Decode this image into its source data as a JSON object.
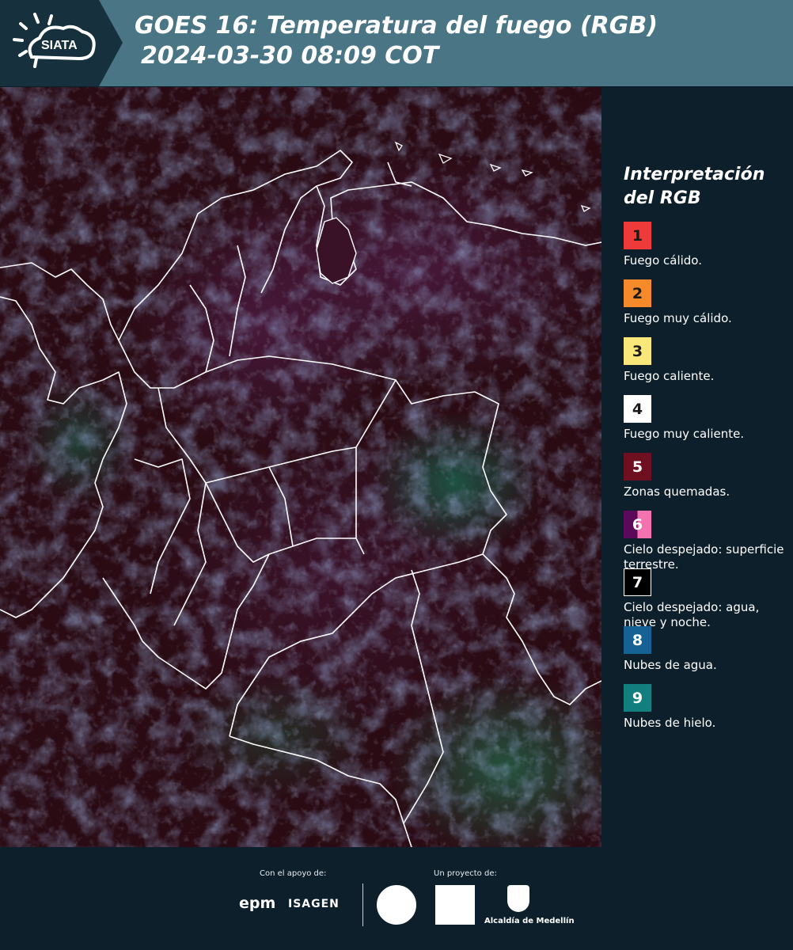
{
  "header": {
    "logo_text": "SIATA",
    "title_line1": "GOES 16: Temperatura del fuego (RGB)",
    "title_line2": "2024-03-30 08:09 COT"
  },
  "legend": {
    "title_line1": "Interpretación",
    "title_line2": "del RGB",
    "items": [
      {
        "number": "1",
        "label": "Fuego cálido.",
        "color": "#ef3a3a",
        "text_color": "#1a1a1a"
      },
      {
        "number": "2",
        "label": "Fuego muy cálido.",
        "color": "#f58a2b",
        "text_color": "#1a1a1a"
      },
      {
        "number": "3",
        "label": "Fuego caliente.",
        "color": "#fae77a",
        "text_color": "#1a1a1a"
      },
      {
        "number": "4",
        "label": "Fuego muy caliente.",
        "color": "#ffffff",
        "text_color": "#1a1a1a"
      },
      {
        "number": "5",
        "label": "Zonas quemadas.",
        "color": "#6e1020",
        "text_color": "#ffffff"
      },
      {
        "number": "6",
        "label": "Cielo despejado: superficie terrestre.",
        "color": "#5b0a5a",
        "color2": "#f273b0",
        "text_color": "#ffffff"
      },
      {
        "number": "7",
        "label": "Cielo despejado: agua, nieve y noche.",
        "color": "#000000",
        "text_color": "#ffffff"
      },
      {
        "number": "8",
        "label": "Nubes de agua.",
        "color": "#166294",
        "text_color": "#ffffff"
      },
      {
        "number": "9",
        "label": "Nubes de hielo.",
        "color": "#137e7e",
        "text_color": "#ffffff"
      }
    ]
  },
  "footer": {
    "support_label": "Con el apoyo de:",
    "project_label": "Un proyecto de:",
    "epm": "epm",
    "isagen": "ISAGEN",
    "alcaldia": "Alcaldía de Medellín"
  }
}
